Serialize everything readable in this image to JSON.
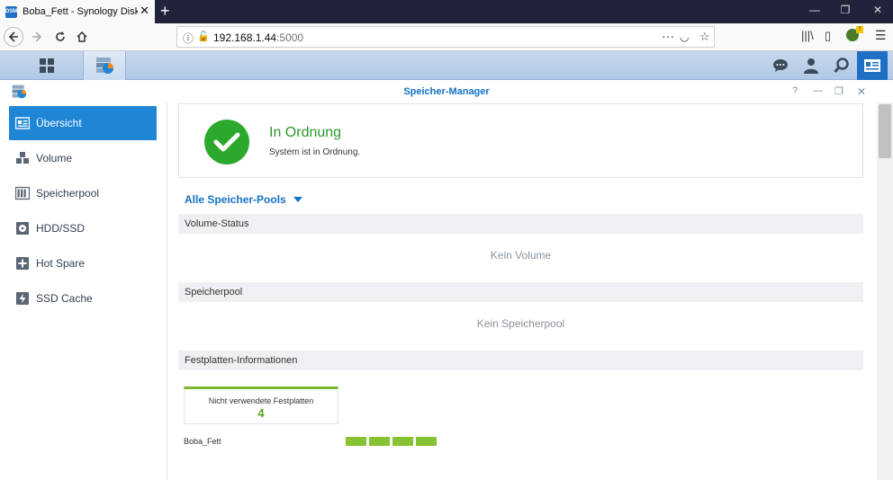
{
  "browser": {
    "tab_title": "Boba_Fett - Synology DiskStation",
    "favicon_text": "DSM",
    "url_host": "192.168.1.44",
    "url_port": ":5000"
  },
  "window": {
    "title": "Speicher-Manager"
  },
  "sidebar": {
    "items": [
      {
        "label": "Übersicht",
        "icon": "overview-icon",
        "active": true
      },
      {
        "label": "Volume",
        "icon": "volume-cubes-icon"
      },
      {
        "label": "Speicherpool",
        "icon": "storage-pool-icon"
      },
      {
        "label": "HDD/SSD",
        "icon": "hdd-icon"
      },
      {
        "label": "Hot Spare",
        "icon": "hot-spare-icon"
      },
      {
        "label": "SSD Cache",
        "icon": "ssd-cache-icon"
      }
    ]
  },
  "status": {
    "title": "In Ordnung",
    "subtitle": "System ist in Ordnung.",
    "color": "#2ca82c"
  },
  "pools_dropdown": "Alle Speicher-Pools",
  "sections": {
    "volume_status": {
      "heading": "Volume-Status",
      "empty": "Kein Volume"
    },
    "storage_pool": {
      "heading": "Speicherpool",
      "empty": "Kein Speicherpool"
    },
    "disk_info": {
      "heading": "Festplatten-Informationen"
    }
  },
  "disks": {
    "unused_label": "Nicht verwendete Festplatten",
    "unused_count": "4",
    "host": "Boba_Fett",
    "slots": 4,
    "slot_color": "#86c232"
  },
  "colors": {
    "accent": "#1f86d6",
    "title_blue": "#1472c4"
  }
}
